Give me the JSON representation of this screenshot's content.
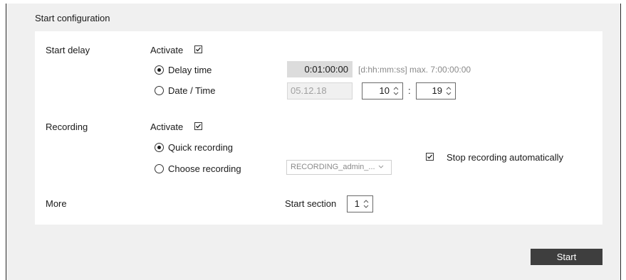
{
  "title": "Start configuration",
  "start_delay": {
    "label": "Start delay",
    "activate_label": "Activate",
    "activate_checked": true,
    "options": [
      {
        "label": "Delay time",
        "selected": true
      },
      {
        "label": "Date / Time",
        "selected": false
      }
    ],
    "delay_value": "0:01:00:00",
    "delay_hint": "[d:hh:mm:ss] max. 7:00:00:00",
    "date_value": "05.12.18",
    "hour_value": "10",
    "separator": ":",
    "minute_value": "19"
  },
  "recording": {
    "label": "Recording",
    "activate_label": "Activate",
    "activate_checked": true,
    "options": [
      {
        "label": "Quick recording",
        "selected": true
      },
      {
        "label": "Choose recording",
        "selected": false
      }
    ],
    "dropdown_value": "RECORDING_admin_...",
    "stop_auto_label": "Stop recording automatically",
    "stop_auto_checked": true
  },
  "more": {
    "label": "More",
    "start_section_label": "Start section",
    "start_section_value": "1"
  },
  "start_button": "Start",
  "colors": {
    "button_bg": "#3e3e3e",
    "panel_bg": "#ffffff",
    "window_bg": "#f0f0f0"
  }
}
